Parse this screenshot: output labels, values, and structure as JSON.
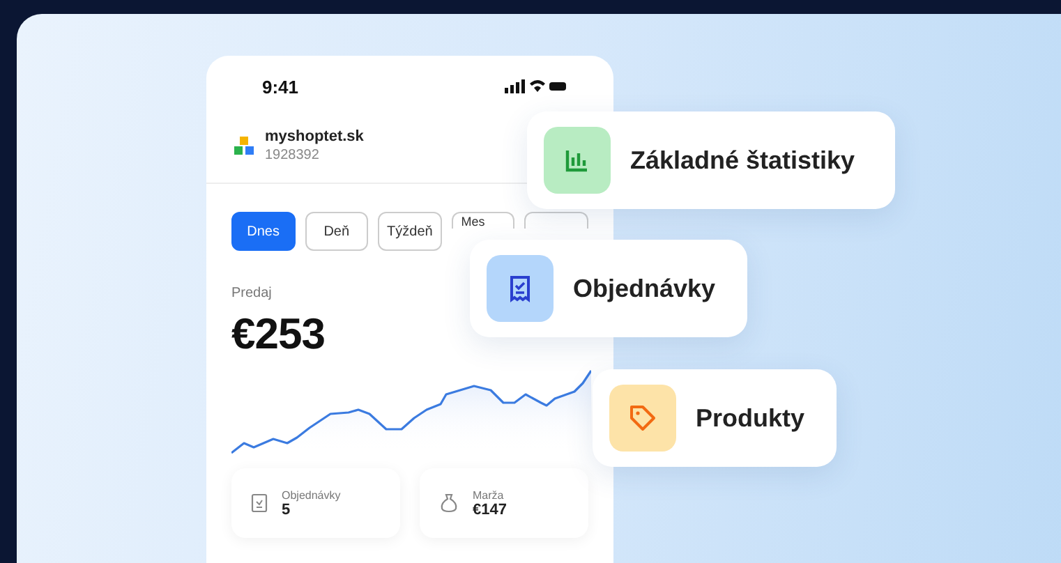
{
  "phone": {
    "time": "9:41",
    "shop": {
      "name": "myshoptet.sk",
      "id": "1928392"
    },
    "tabs": [
      {
        "label": "Dnes",
        "selected": true
      },
      {
        "label": "Deň",
        "selected": false
      },
      {
        "label": "Týždeň",
        "selected": false
      },
      {
        "label": "Mes",
        "selected": false
      },
      {
        "selected": false
      }
    ],
    "sales": {
      "label": "Predaj",
      "value": "€253"
    },
    "stats": [
      {
        "kind": "receipt",
        "label": "Objednávky",
        "value": "5"
      },
      {
        "kind": "bag",
        "label": "Marža",
        "value": "€147"
      }
    ]
  },
  "features": [
    {
      "kind": "stats",
      "label": "Základné štatistiky"
    },
    {
      "kind": "orders",
      "label": "Objednávky"
    },
    {
      "kind": "products",
      "label": "Produkty"
    }
  ]
}
